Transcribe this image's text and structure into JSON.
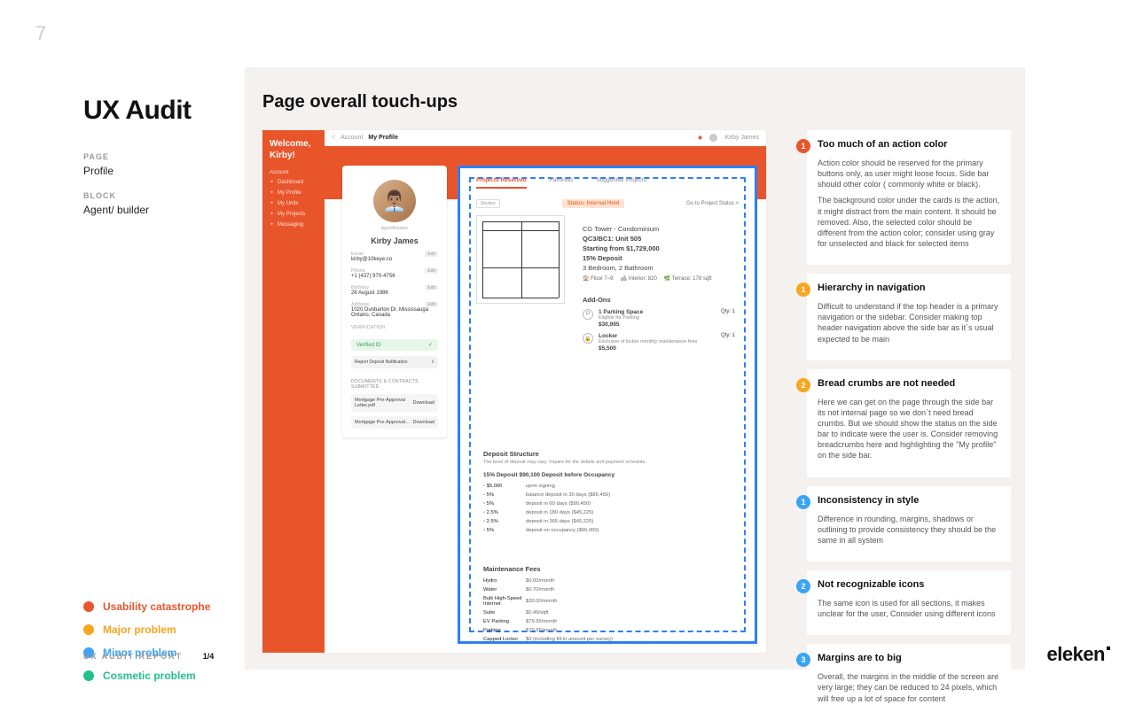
{
  "page_number": "7",
  "report_title": "UX Audit",
  "meta": {
    "page_label": "PAGE",
    "page_value": "Profile",
    "block_label": "BLOCK",
    "block_value": "Agent/ builder"
  },
  "legend": [
    {
      "color": "#ea552c",
      "label": "Usability catastrophe",
      "text_color": "#ea552c"
    },
    {
      "color": "#f6a61f",
      "label": "Major problem",
      "text_color": "#f6a61f"
    },
    {
      "color": "#39a4f4",
      "label": "Minor problem",
      "text_color": "#39a4f4"
    },
    {
      "color": "#25c08b",
      "label": "Cosmetic problem",
      "text_color": "#25c08b"
    }
  ],
  "footer": {
    "label": "UX AUDIT REPORT",
    "page": "1/4"
  },
  "brand": "eleken",
  "section_title": "Page overall touch-ups",
  "app": {
    "welcome": "Welcome, Kirby!",
    "nav_section": "Account",
    "nav_items": [
      "Dashboard",
      "My Profile",
      "My Units",
      "My Projects",
      "Messaging"
    ],
    "breadcrumb": [
      "Account",
      "My Profile"
    ],
    "topbar_user": "Kirby James",
    "profile": {
      "name": "Kirby James",
      "email_lbl": "Email",
      "email": "kirby@10keye.co",
      "phone_lbl": "Phone",
      "phone": "+1 (437) 970-4756",
      "bday_lbl": "Birthday",
      "bday": "26 August 1986",
      "addr_lbl": "Address",
      "addr": "1020 Dunbarton Dr. Mississauga Ontario, Canada",
      "verified_lbl": "VERIFICATION",
      "verified": "Verified ID",
      "docs_lbl": "DOCUMENTS & CONTRACTS SUBMITTED",
      "doc1": "Mortgage Pre-Approval Letter.pdf",
      "doc2": "Mortgage Pre-Approval…",
      "edit": "Edit",
      "download": "Download"
    },
    "tabs": [
      "Projects Reserved",
      "Favorites",
      "Suggested Projects"
    ],
    "status_badge": "Status: Internal Hold",
    "goto": "Go to Project Status  >",
    "unit": {
      "l1": "CG Tower - Condominium",
      "l2": "QC3/BC1: Unit 505",
      "l3": "Starting from $1,729,000",
      "l4": "15% Deposit",
      "l5": "3 Bedroom, 2 Bathroom",
      "sub": [
        "🏠 Floor 7–9",
        "🛋 Interior: 820",
        "🌿 Terrace: 178 sqft"
      ]
    },
    "addons_label": "Add-Ons",
    "addons": [
      {
        "icon": "P",
        "title": "1 Parking Space",
        "sub": "Eligible for Parking",
        "price": "$30,995",
        "qty": "Qty: 1"
      },
      {
        "icon": "🔒",
        "title": "Locker",
        "sub": "Exclusive of locker monthly maintenance fees",
        "price": "$5,500",
        "qty": "Qty: 1"
      }
    ],
    "deposit": {
      "heading": "Deposit Structure",
      "sub": "The level of deposit may vary. Inquire for the details and payment schedule.",
      "summary": "15% Deposit     $90,100 Deposit before Occupancy",
      "rows": [
        [
          "$5,000",
          "upon signing"
        ],
        [
          "5%",
          "balance deposit in 30 days ($85,450)"
        ],
        [
          "5%",
          "deposit in 60 days ($90,450)"
        ],
        [
          "2.5%",
          "deposit in 180 days ($45,225)"
        ],
        [
          "2.5%",
          "deposit in 365 days ($45,225)"
        ],
        [
          "5%",
          "deposit on occupancy ($90,450)"
        ]
      ]
    },
    "maint": {
      "heading": "Maintenance Fees",
      "rows": [
        [
          "Hydro",
          "$0.00/month"
        ],
        [
          "Water",
          "$0.70/month"
        ],
        [
          "Bulk High-Speed Internet",
          "$30.00/month"
        ],
        [
          "Suite",
          "$0.49/sqft"
        ],
        [
          "EV Parking",
          "$79.95/month"
        ],
        [
          "Parking",
          "$79.95/month"
        ],
        [
          "Capped Locker",
          "$0 (including fill-in amount per survey)"
        ]
      ]
    }
  },
  "notes": [
    {
      "num": "1",
      "color": "c-red",
      "title": "Too much of an action color",
      "body": [
        "Action color should be reserved for the primary buttons only, as user might loose focus. Side bar should other color ( commonly white or black).",
        "The background color under the cards is  the action, it might distract from the main content. It should be removed. Also, the selected color should be different from the action color; consider using gray for unselected and black for selected items"
      ]
    },
    {
      "num": "1",
      "color": "c-orange",
      "title": "Hierarchy in navigation",
      "body": [
        "Difficult to understand if the top header is a primary navigation or the sidebar. Consider making top header navigation above the side bar as it`s usual expected to be main"
      ]
    },
    {
      "num": "2",
      "color": "c-orange",
      "title": "Bread crumbs are not needed",
      "body": [
        "Here we can get on the page through the side bar its not internal page so we don`t need bread crumbs. But we should show the status on the side bar to indicate were the user is. Consider removing breadcrumbs here and highlighting  the \"My profile\" on the side bar."
      ]
    },
    {
      "num": "1",
      "color": "c-blue",
      "title": "Inconsistency in style",
      "body": [
        "Difference in rounding, margins, shadows or outlining to provide consistency they should be the same in all system"
      ]
    },
    {
      "num": "2",
      "color": "c-blue",
      "title": "Not recognizable icons",
      "body": [
        "The same icon is used for all sections, it makes unclear for the user, Consider using different icons"
      ]
    },
    {
      "num": "3",
      "color": "c-blue",
      "title": "Margins are to big",
      "body": [
        "Overall, the margins in the middle of the screen are very large; they can be reduced to 24 pixels, which will free up a lot of space for content"
      ]
    }
  ]
}
